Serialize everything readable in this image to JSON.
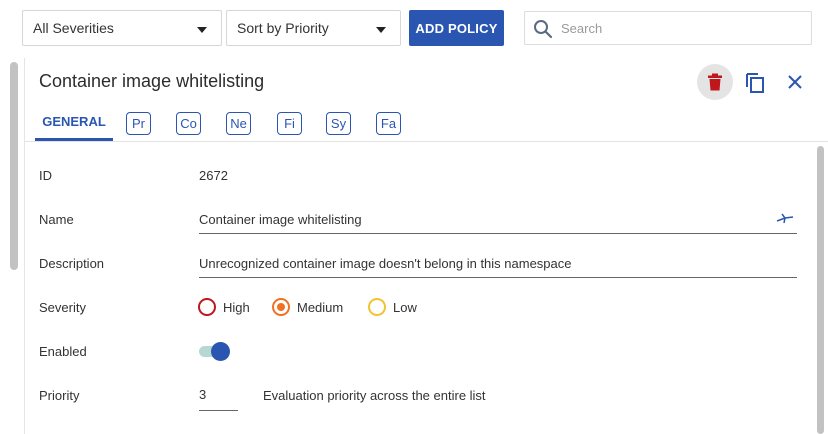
{
  "toolbar": {
    "severity_filter": "All Severities",
    "sort_select": "Sort by Priority",
    "add_policy_label": "ADD POLICY",
    "search_placeholder": "Search"
  },
  "panel": {
    "title": "Container image whitelisting",
    "actions": {
      "delete": "trash-icon",
      "copy": "copy-icon",
      "close": "close-icon"
    },
    "tabs": {
      "active": "GENERAL",
      "chips": [
        "Pr",
        "Co",
        "Ne",
        "Fi",
        "Sy",
        "Fa"
      ]
    }
  },
  "form": {
    "id": {
      "label": "ID",
      "value": "2672"
    },
    "name": {
      "label": "Name",
      "value": "Container image whitelisting"
    },
    "description": {
      "label": "Description",
      "value": "Unrecognized container image doesn't belong in this namespace"
    },
    "severity": {
      "label": "Severity",
      "options": [
        "High",
        "Medium",
        "Low"
      ],
      "selected": "Medium"
    },
    "enabled": {
      "label": "Enabled",
      "value": true
    },
    "priority": {
      "label": "Priority",
      "value": "3",
      "hint": "Evaluation priority across the entire list"
    }
  },
  "colors": {
    "accent": "#2a56b2",
    "delete": "#c0171d",
    "severity_high": "#c0171d",
    "severity_medium": "#f07124",
    "severity_low": "#f2c230"
  }
}
